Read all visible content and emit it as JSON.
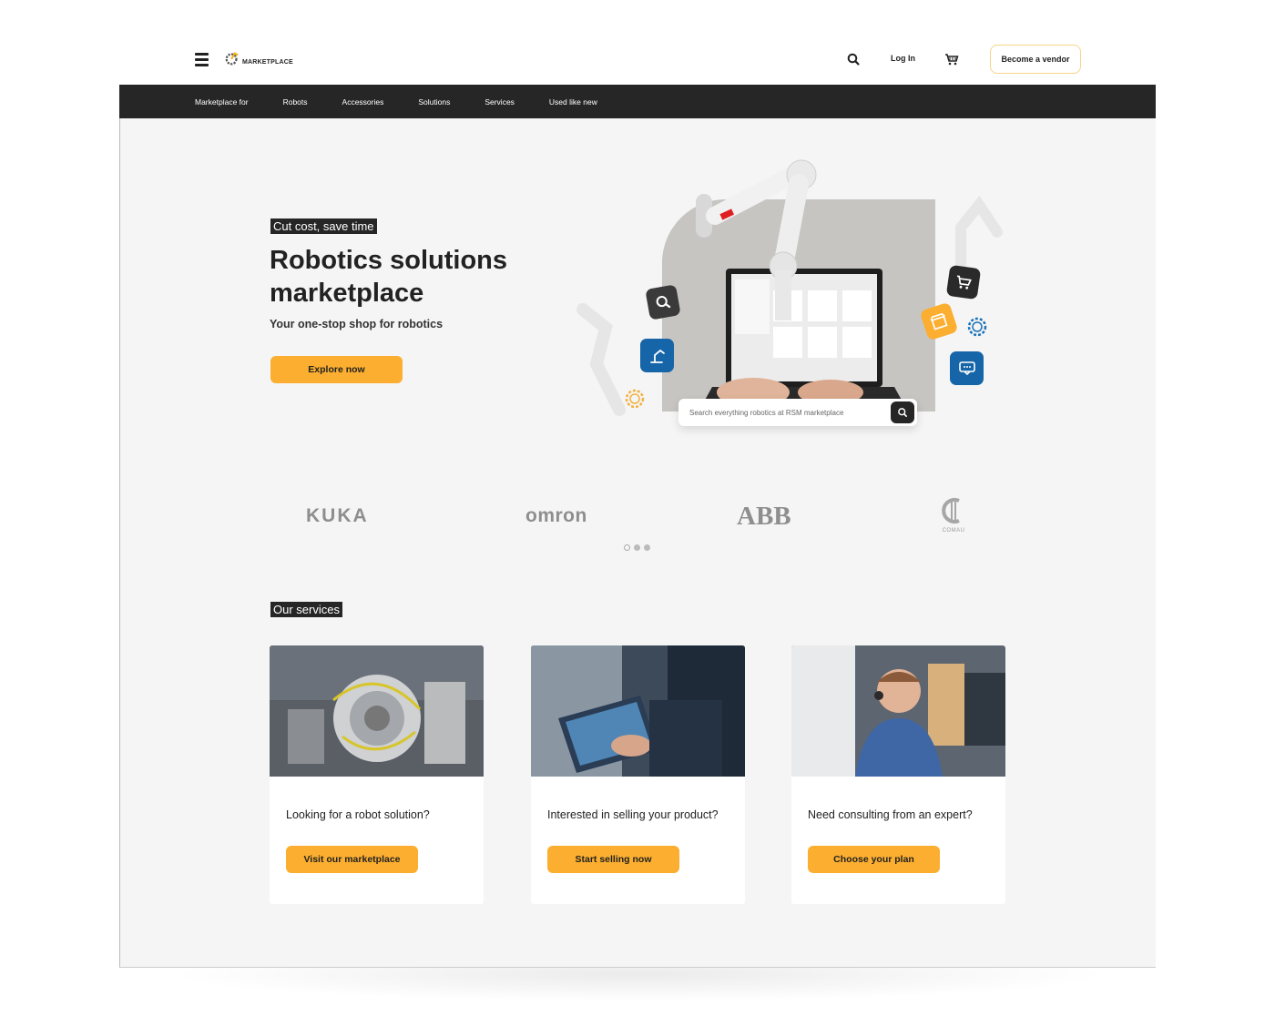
{
  "header": {
    "logo_text": "MARKETPLACE",
    "login_label": "Log In",
    "vendor_label": "Become a vendor"
  },
  "nav": {
    "items": [
      "Marketplace for",
      "Robots",
      "Accessories",
      "Solutions",
      "Services",
      "Used like new"
    ]
  },
  "hero": {
    "tag": "Cut cost, save time",
    "title": "Robotics solutions marketplace",
    "subtitle": "Your one-stop shop for robotics",
    "cta_label": "Explore now",
    "search_placeholder": "Search everything robotics at RSM marketplace"
  },
  "brands": {
    "items": [
      "KUKA",
      "OMRON",
      "ABB",
      "COMAU"
    ],
    "carousel_active_index": 0,
    "carousel_count": 3
  },
  "services": {
    "tag": "Our services",
    "cards": [
      {
        "title": "Looking for a robot solution?",
        "button": "Visit our marketplace"
      },
      {
        "title": "Interested in selling your product?",
        "button": "Start selling now"
      },
      {
        "title": "Need consulting from an expert?",
        "button": "Choose your plan"
      }
    ]
  },
  "colors": {
    "accent": "#fbae2f",
    "nav_bg": "#262626",
    "page_bg": "#f5f5f5",
    "icon_blue": "#1565a8"
  },
  "icons": [
    "menu-icon",
    "search-icon",
    "cart-icon",
    "gear-icon",
    "chat-icon",
    "robot-arm-icon"
  ]
}
